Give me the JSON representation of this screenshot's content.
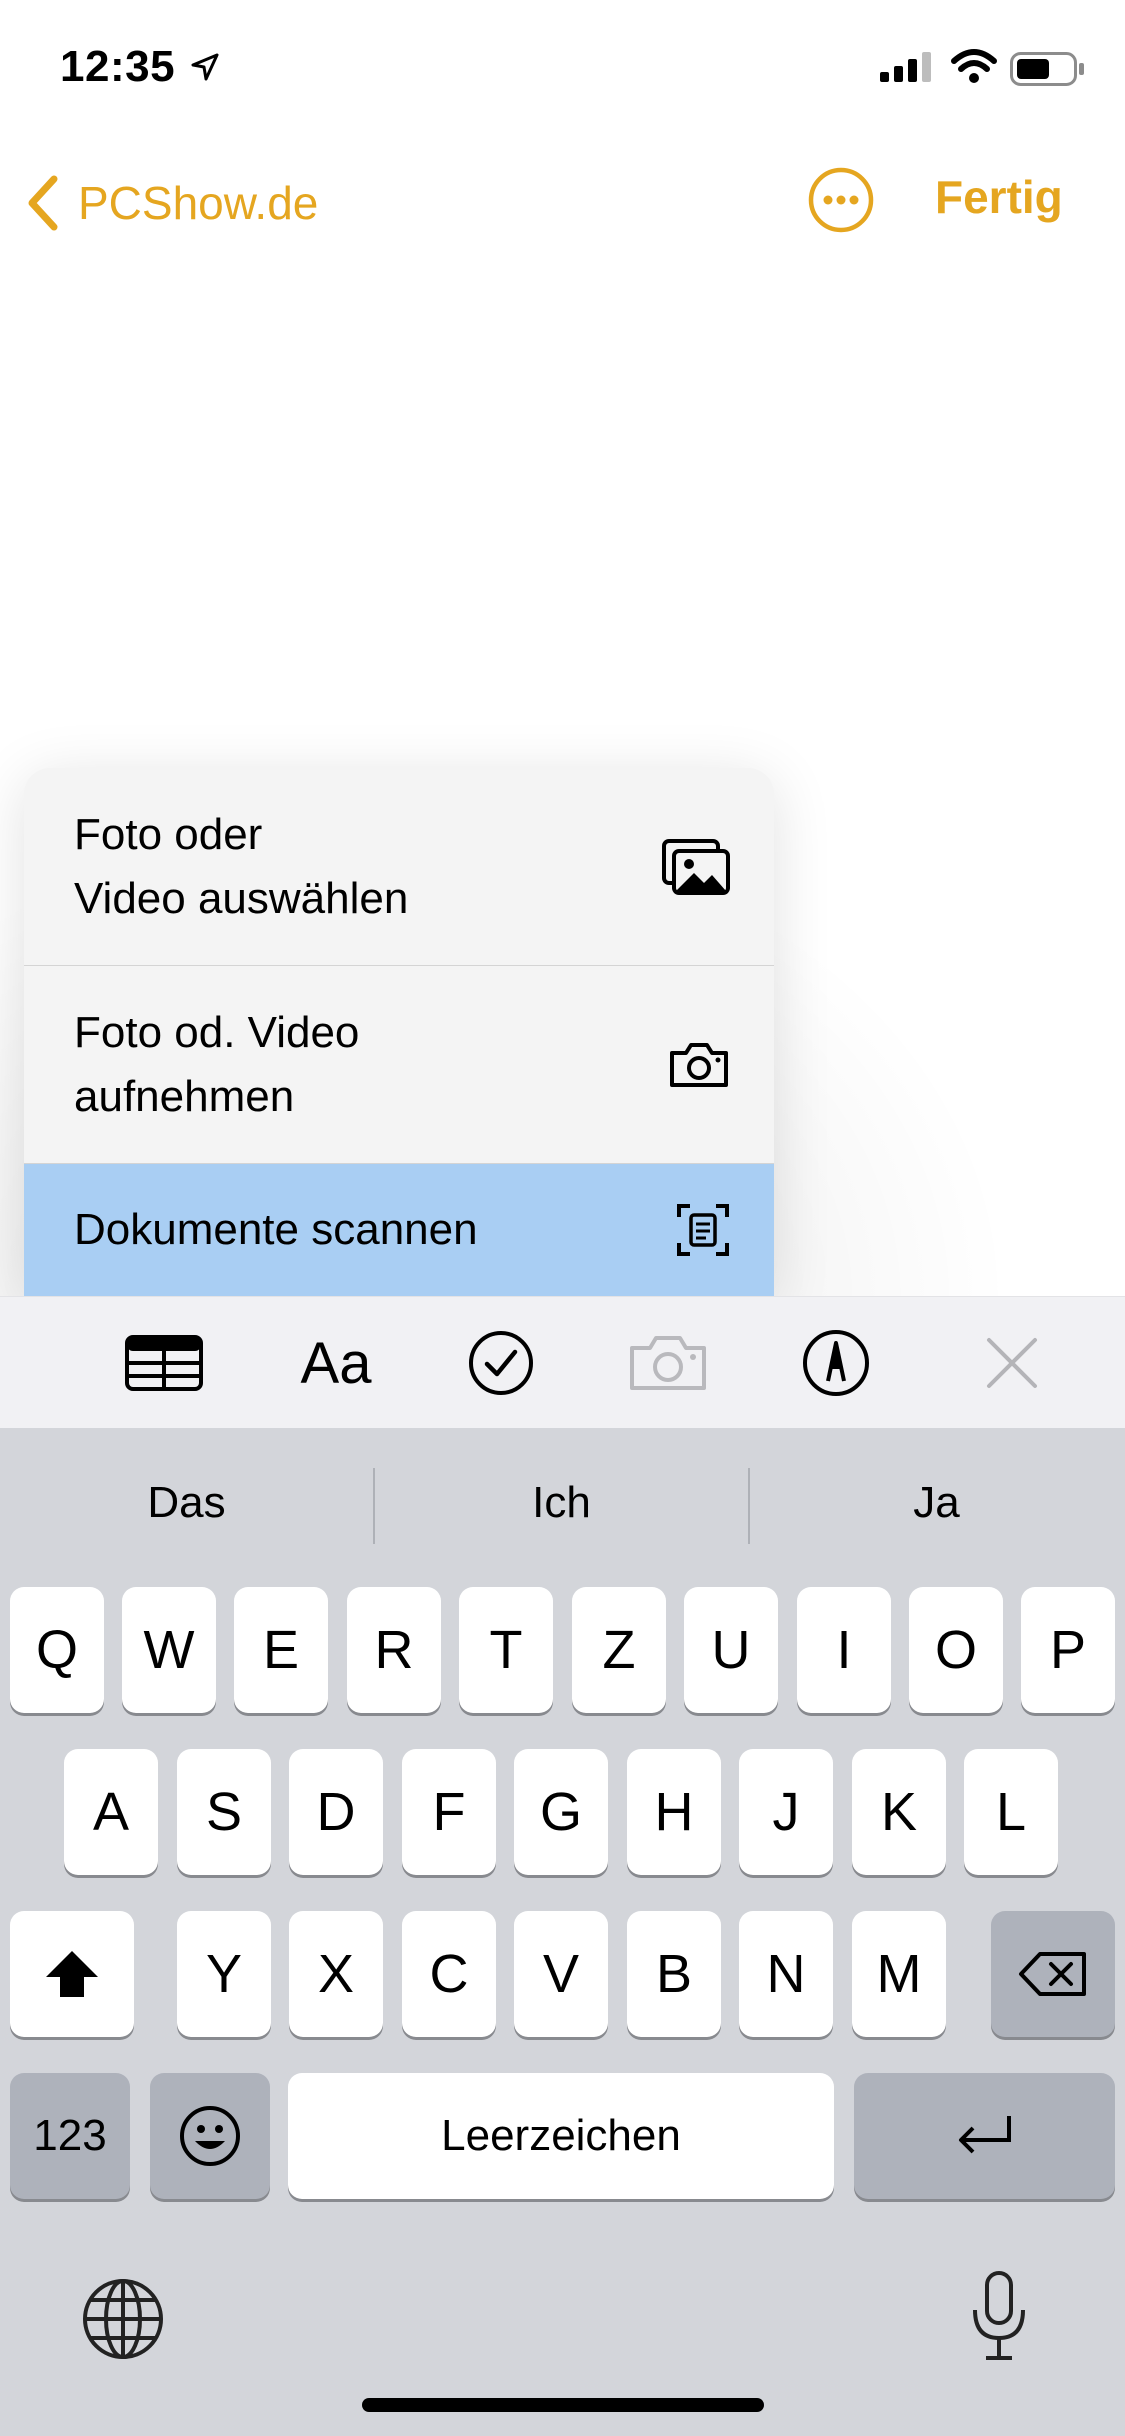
{
  "status_bar": {
    "time": "12:35"
  },
  "nav": {
    "back_label": "PCShow.de",
    "done_label": "Fertig",
    "accent_color": "#E5A620"
  },
  "menu": {
    "items": [
      {
        "label": "Foto oder\nVideo auswählen",
        "icon": "photo-library-icon"
      },
      {
        "label": "Foto od. Video\naufnehmen",
        "icon": "camera-icon"
      },
      {
        "label": "Dokumente scannen",
        "icon": "document-scan-icon",
        "highlighted": true
      }
    ],
    "highlight_color": "#A9CEF3"
  },
  "toolbar": {
    "items": [
      "table-icon",
      "text-format-icon",
      "checklist-icon",
      "camera-icon",
      "markup-icon",
      "close-icon"
    ],
    "text_format_label": "Aa"
  },
  "keyboard": {
    "suggestions": [
      "Das",
      "Ich",
      "Ja"
    ],
    "row1": [
      "Q",
      "W",
      "E",
      "R",
      "T",
      "Z",
      "U",
      "I",
      "O",
      "P"
    ],
    "row2": [
      "A",
      "S",
      "D",
      "F",
      "G",
      "H",
      "J",
      "K",
      "L"
    ],
    "row3": [
      "Y",
      "X",
      "C",
      "V",
      "B",
      "N",
      "M"
    ],
    "numbers_label": "123",
    "space_label": "Leerzeichen"
  }
}
